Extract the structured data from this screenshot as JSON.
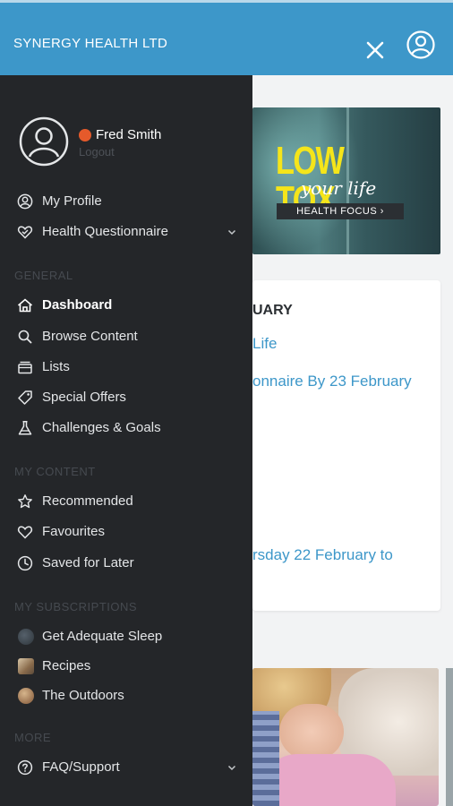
{
  "header": {
    "brand": "SYNERGY HEALTH LTD"
  },
  "user": {
    "name": "Fred Smith",
    "logout_label": "Logout",
    "status_color": "#e55a2b"
  },
  "nav": {
    "top": [
      {
        "label": "My Profile",
        "icon": "user-circle-icon"
      },
      {
        "label": "Health Questionnaire",
        "icon": "heart-check-icon",
        "expandable": true
      }
    ],
    "general_title": "GENERAL",
    "general": [
      {
        "label": "Dashboard",
        "icon": "home-icon",
        "active": true
      },
      {
        "label": "Browse Content",
        "icon": "search-icon"
      },
      {
        "label": "Lists",
        "icon": "lists-icon"
      },
      {
        "label": "Special Offers",
        "icon": "tag-icon"
      },
      {
        "label": "Challenges & Goals",
        "icon": "flask-icon"
      }
    ],
    "my_content_title": "MY CONTENT",
    "my_content": [
      {
        "label": "Recommended",
        "icon": "star-icon"
      },
      {
        "label": "Favourites",
        "icon": "heart-icon"
      },
      {
        "label": "Saved for Later",
        "icon": "clock-icon"
      }
    ],
    "subscriptions_title": "MY SUBSCRIPTIONS",
    "subscriptions": [
      {
        "label": "Get Adequate Sleep"
      },
      {
        "label": "Recipes"
      },
      {
        "label": "The Outdoors"
      }
    ],
    "more_title": "MORE",
    "more": [
      {
        "label": "FAQ/Support",
        "icon": "help-icon",
        "expandable": true
      }
    ]
  },
  "background": {
    "banner_title": "LOW TOX",
    "banner_sub": "your life",
    "banner_cta": "HEALTH FOCUS ›",
    "card_month": "UARY",
    "card_link1": "Life",
    "card_link2": "onnaire By 23 February",
    "card_link3": "rsday 22 February to"
  },
  "colors": {
    "accent": "#3d97c9",
    "drawer": "#242629"
  }
}
